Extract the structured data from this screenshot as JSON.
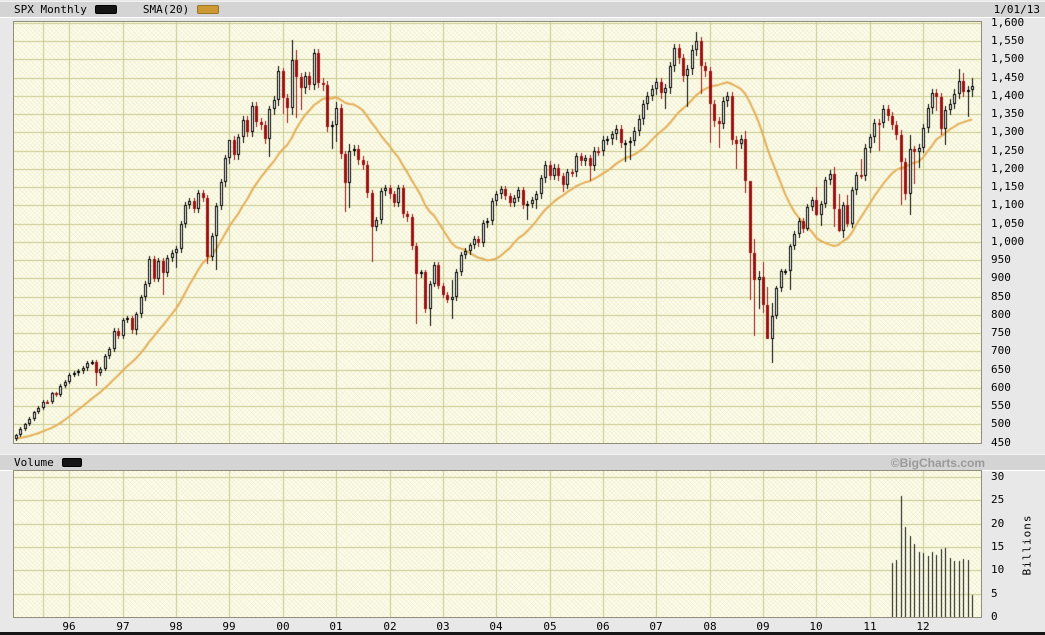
{
  "window": {
    "date_label": "1/01/13",
    "copyright": "©BigCharts.com"
  },
  "legend": {
    "series_label": "SPX Monthly",
    "sma_label": "SMA(20)"
  },
  "volume_legend": {
    "label": "Volume",
    "ylabel": "Billions"
  },
  "colors": {
    "up_candle_fill": "#ffffff",
    "up_candle_outline": "#000000",
    "down_candle": "#9b1111",
    "sma_line": "#e3ae56",
    "sma_swatch": "#cc9933",
    "grid": "#c9c98e",
    "plot_bg": "#fdfdea",
    "volume_bar": "#111111",
    "header_bg": "#d4d4d4",
    "page_bg": "#e8e8e8"
  },
  "chart_data": {
    "type": "candlestick",
    "title": "SPX Monthly",
    "overlay": "SMA(20)",
    "x_axis": {
      "year_labels": [
        "96",
        "97",
        "98",
        "99",
        "00",
        "01",
        "02",
        "03",
        "04",
        "05",
        "06",
        "07",
        "08",
        "09",
        "10",
        "11",
        "12"
      ]
    },
    "price_axis": {
      "min": 450,
      "max": 1600,
      "tick_step": 50
    },
    "start_month": "1995-01",
    "first_open": 459.27,
    "sma_period": 20,
    "pre_closes": [
      450.53,
      448.13,
      463.56,
      458.93,
      467.83,
      461.79,
      466.45,
      481.61,
      467.14,
      445.77,
      450.91,
      456.5,
      444.27,
      458.26,
      475.49,
      462.69,
      472.35,
      453.69,
      459.27
    ],
    "closes": [
      470.42,
      487.39,
      500.71,
      514.71,
      533.4,
      544.75,
      562.06,
      561.88,
      584.41,
      581.5,
      605.37,
      615.93,
      636.02,
      640.43,
      645.5,
      654.17,
      669.12,
      670.63,
      639.95,
      651.99,
      687.33,
      705.27,
      757.02,
      740.74,
      786.16,
      790.82,
      757.12,
      801.34,
      848.28,
      885.14,
      954.31,
      899.47,
      947.28,
      914.62,
      955.4,
      970.43,
      980.28,
      1049.34,
      1101.75,
      1111.75,
      1090.82,
      1133.84,
      1120.67,
      957.28,
      1017.01,
      1098.67,
      1163.63,
      1229.23,
      1279.64,
      1238.33,
      1286.37,
      1335.18,
      1301.84,
      1372.71,
      1328.72,
      1320.41,
      1282.71,
      1362.93,
      1388.91,
      1469.25,
      1394.46,
      1366.42,
      1498.58,
      1452.43,
      1420.6,
      1454.6,
      1430.83,
      1517.68,
      1436.51,
      1429.4,
      1314.95,
      1320.28,
      1366.01,
      1239.94,
      1160.33,
      1249.46,
      1255.82,
      1224.38,
      1211.23,
      1133.58,
      1040.94,
      1059.78,
      1139.45,
      1148.08,
      1130.2,
      1106.73,
      1147.39,
      1076.92,
      1067.14,
      989.82,
      911.62,
      916.07,
      815.28,
      885.76,
      936.31,
      879.82,
      855.7,
      841.15,
      848.18,
      916.92,
      963.59,
      974.5,
      990.31,
      1008.01,
      995.97,
      1050.71,
      1058.2,
      1111.92,
      1131.13,
      1144.94,
      1126.21,
      1107.3,
      1120.68,
      1140.84,
      1101.72,
      1104.24,
      1114.58,
      1130.2,
      1173.82,
      1211.92,
      1181.27,
      1203.6,
      1180.59,
      1156.85,
      1191.5,
      1191.33,
      1234.18,
      1220.33,
      1228.81,
      1207.01,
      1249.48,
      1248.29,
      1280.08,
      1280.66,
      1294.87,
      1310.61,
      1270.09,
      1270.2,
      1276.66,
      1303.82,
      1335.85,
      1377.94,
      1400.63,
      1418.3,
      1438.24,
      1406.82,
      1420.86,
      1482.37,
      1530.62,
      1503.35,
      1455.27,
      1473.99,
      1526.75,
      1549.38,
      1481.14,
      1468.36,
      1378.55,
      1330.63,
      1322.7,
      1385.59,
      1400.38,
      1280.0,
      1267.38,
      1282.83,
      1166.36,
      968.75,
      896.24,
      903.25,
      825.88,
      735.09,
      797.87,
      872.81,
      919.14,
      919.32,
      987.48,
      1020.62,
      1057.08,
      1036.19,
      1095.63,
      1115.1,
      1073.87,
      1104.49,
      1169.43,
      1186.69,
      1089.41,
      1030.71,
      1101.6,
      1049.33,
      1141.2,
      1183.26,
      1180.55,
      1257.64,
      1286.12,
      1327.22,
      1325.83,
      1363.61,
      1345.2,
      1320.64,
      1292.28,
      1218.89,
      1131.42,
      1253.3,
      1246.96,
      1257.6,
      1312.41,
      1365.68,
      1408.47,
      1397.91,
      1310.33,
      1362.16,
      1379.32,
      1406.58,
      1440.67,
      1412.16,
      1416.18,
      1426.19
    ],
    "default_wick_high_pct": 0.008,
    "default_wick_low_pct": 0.011,
    "hl_overrides": {
      "1996-07": {
        "low": 605.0
      },
      "1997-04": {
        "low": 744.0
      },
      "1997-10": {
        "low": 855.0
      },
      "1998-01": {
        "low": 927.0
      },
      "1998-08": {
        "low": 940.0
      },
      "1998-10": {
        "low": 923.3
      },
      "1999-01": {
        "high": 1280.4,
        "low": 1212.2
      },
      "1999-10": {
        "low": 1233.7
      },
      "2000-01": {
        "high": 1478.0,
        "low": 1350.1
      },
      "2000-02": {
        "low": 1325.0
      },
      "2000-03": {
        "high": 1552.9,
        "low": 1346.6
      },
      "2000-04": {
        "high": 1527.2,
        "low": 1339.4
      },
      "2000-05": {
        "low": 1361.1
      },
      "2000-12": {
        "low": 1254.1
      },
      "2001-01": {
        "high": 1383.4,
        "low": 1274.6
      },
      "2001-03": {
        "low": 1081.2
      },
      "2001-04": {
        "high": 1269.3,
        "low": 1092.0
      },
      "2001-09": {
        "low": 944.8
      },
      "2002-07": {
        "low": 775.7
      },
      "2002-10": {
        "low": 768.6
      },
      "2003-03": {
        "high": 895.9,
        "low": 788.9
      },
      "2004-08": {
        "low": 1060.7
      },
      "2004-10": {
        "low": 1090.2
      },
      "2005-04": {
        "low": 1136.2
      },
      "2005-10": {
        "low": 1168.2
      },
      "2006-06": {
        "low": 1219.3
      },
      "2006-07": {
        "low": 1224.5
      },
      "2007-03": {
        "low": 1364.0
      },
      "2007-08": {
        "low": 1370.6
      },
      "2007-10": {
        "high": 1576.1
      },
      "2007-11": {
        "low": 1406.1
      },
      "2008-01": {
        "low": 1270.0
      },
      "2008-03": {
        "low": 1257.0
      },
      "2008-07": {
        "low": 1200.4
      },
      "2008-09": {
        "high": 1303.0,
        "low": 1133.5
      },
      "2008-10": {
        "high": 1167.0,
        "low": 839.8
      },
      "2008-11": {
        "high": 1007.5,
        "low": 741.0
      },
      "2008-12": {
        "high": 918.9,
        "low": 815.7
      },
      "2009-01": {
        "high": 943.9,
        "low": 804.3
      },
      "2009-02": {
        "high": 875.0,
        "low": 734.5
      },
      "2009-03": {
        "high": 833.0,
        "low": 666.8
      },
      "2009-07": {
        "low": 869.3
      },
      "2009-11": {
        "low": 1029.4
      },
      "2010-01": {
        "high": 1150.5,
        "low": 1071.6
      },
      "2010-02": {
        "low": 1044.5
      },
      "2010-05": {
        "high": 1205.1,
        "low": 1040.8
      },
      "2010-06": {
        "high": 1131.2,
        "low": 1028.3
      },
      "2010-07": {
        "low": 1010.9
      },
      "2010-08": {
        "high": 1129.2,
        "low": 1039.7
      },
      "2010-11": {
        "high": 1227.1,
        "low": 1173.0
      },
      "2011-03": {
        "low": 1249.1
      },
      "2011-08": {
        "high": 1307.4,
        "low": 1101.5
      },
      "2011-09": {
        "low": 1114.2
      },
      "2011-10": {
        "high": 1292.7,
        "low": 1074.8
      },
      "2011-11": {
        "low": 1158.7
      },
      "2011-12": {
        "high": 1269.4,
        "low": 1202.4
      },
      "2012-04": {
        "low": 1357.4
      },
      "2012-05": {
        "low": 1292.0
      },
      "2012-06": {
        "low": 1266.7
      },
      "2012-09": {
        "high": 1474.5
      },
      "2012-10": {
        "high": 1464.0
      },
      "2012-11": {
        "low": 1343.4
      },
      "2012-12": {
        "high": 1448.0,
        "low": 1398.2
      }
    },
    "volume": {
      "type": "bar",
      "name": "Volume",
      "unit": "Billions",
      "start_month": "2011-06",
      "axis": {
        "min": 0,
        "max": 30,
        "tick_step": 5
      },
      "values_billions": [
        11.5,
        12.3,
        26.0,
        19.2,
        17.4,
        15.6,
        13.9,
        13.8,
        13.1,
        14.0,
        13.2,
        14.6,
        14.8,
        12.6,
        12.0,
        12.1,
        12.4,
        12.3,
        4.8
      ]
    }
  }
}
